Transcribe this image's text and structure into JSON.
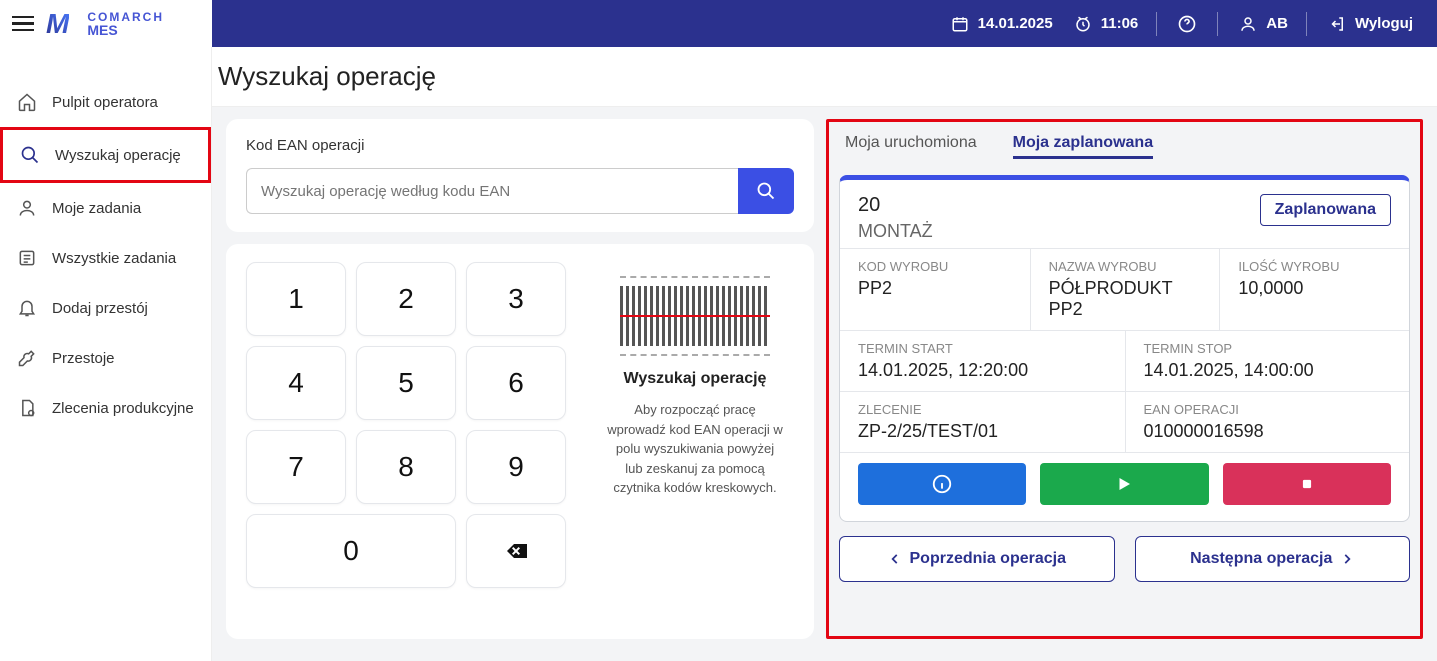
{
  "header": {
    "brand_top": "COMARCH",
    "brand_bottom": "MES",
    "date": "14.01.2025",
    "time": "11:06",
    "user": "AB",
    "logout": "Wyloguj"
  },
  "sidebar": {
    "items": [
      {
        "label": "Pulpit operatora"
      },
      {
        "label": "Wyszukaj operację"
      },
      {
        "label": "Moje zadania"
      },
      {
        "label": "Wszystkie zadania"
      },
      {
        "label": "Dodaj przestój"
      },
      {
        "label": "Przestoje"
      },
      {
        "label": "Zlecenia produkcyjne"
      }
    ]
  },
  "page": {
    "title": "Wyszukaj operację",
    "search_label": "Kod EAN operacji",
    "search_placeholder": "Wyszukaj operację według kodu EAN",
    "keys": [
      "1",
      "2",
      "3",
      "4",
      "5",
      "6",
      "7",
      "8",
      "9",
      "0"
    ],
    "scan_title": "Wyszukaj operację",
    "scan_hint": "Aby rozpocząć pracę wprowadź kod EAN operacji w polu wyszukiwania powyżej lub zeskanuj za pomocą czytnika kodów kreskowych."
  },
  "tabs": {
    "running": "Moja uruchomiona",
    "planned": "Moja zaplanowana"
  },
  "operation": {
    "seq": "20",
    "name": "MONTAŻ",
    "status": "Zaplanowana",
    "fields": {
      "kod_wyrobu_k": "KOD WYROBU",
      "kod_wyrobu_v": "PP2",
      "nazwa_wyrobu_k": "NAZWA WYROBU",
      "nazwa_wyrobu_v": "PÓŁPRODUKT PP2",
      "ilosc_k": "ILOŚĆ WYROBU",
      "ilosc_v": "10,0000",
      "start_k": "TERMIN START",
      "start_v": "14.01.2025, 12:20:00",
      "stop_k": "TERMIN STOP",
      "stop_v": "14.01.2025, 14:00:00",
      "zlecenie_k": "ZLECENIE",
      "zlecenie_v": "ZP-2/25/TEST/01",
      "ean_k": "EAN OPERACJI",
      "ean_v": "010000016598"
    }
  },
  "nav": {
    "prev": "Poprzednia operacja",
    "next": "Następna operacja"
  }
}
